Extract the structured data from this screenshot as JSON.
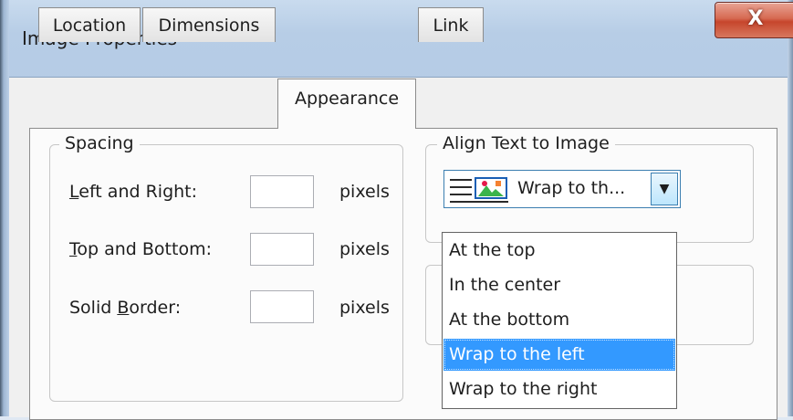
{
  "window": {
    "title": "Image Properties",
    "close_glyph": "X"
  },
  "tabs": [
    {
      "label": "Location",
      "active": false
    },
    {
      "label": "Dimensions",
      "active": false
    },
    {
      "label": "Appearance",
      "active": true
    },
    {
      "label": "Link",
      "active": false
    }
  ],
  "spacing": {
    "group_label": "Spacing",
    "rows": [
      {
        "label_mnemonic": "L",
        "label_rest": "eft and Right:",
        "value": "",
        "unit": "pixels"
      },
      {
        "label_mnemonic": "T",
        "label_rest": "op and Bottom:",
        "value": "",
        "unit": "pixels"
      },
      {
        "label_prefix": "Solid ",
        "label_mnemonic": "B",
        "label_rest": "order:",
        "value": "",
        "unit": "pixels"
      }
    ]
  },
  "align": {
    "group_label": "Align Text to Image",
    "selected_text": "Wrap to th...",
    "icon": "wrap-left-icon",
    "dropdown_arrow": "▼",
    "options": [
      {
        "label": "At the top",
        "selected": false
      },
      {
        "label": "In the center",
        "selected": false
      },
      {
        "label": "At the bottom",
        "selected": false
      },
      {
        "label": "Wrap to the left",
        "selected": true
      },
      {
        "label": "Wrap to the right",
        "selected": false
      }
    ]
  },
  "colors": {
    "selection": "#3399ff",
    "close_button": "#c6452c",
    "focus_border": "#3c7fb1"
  }
}
